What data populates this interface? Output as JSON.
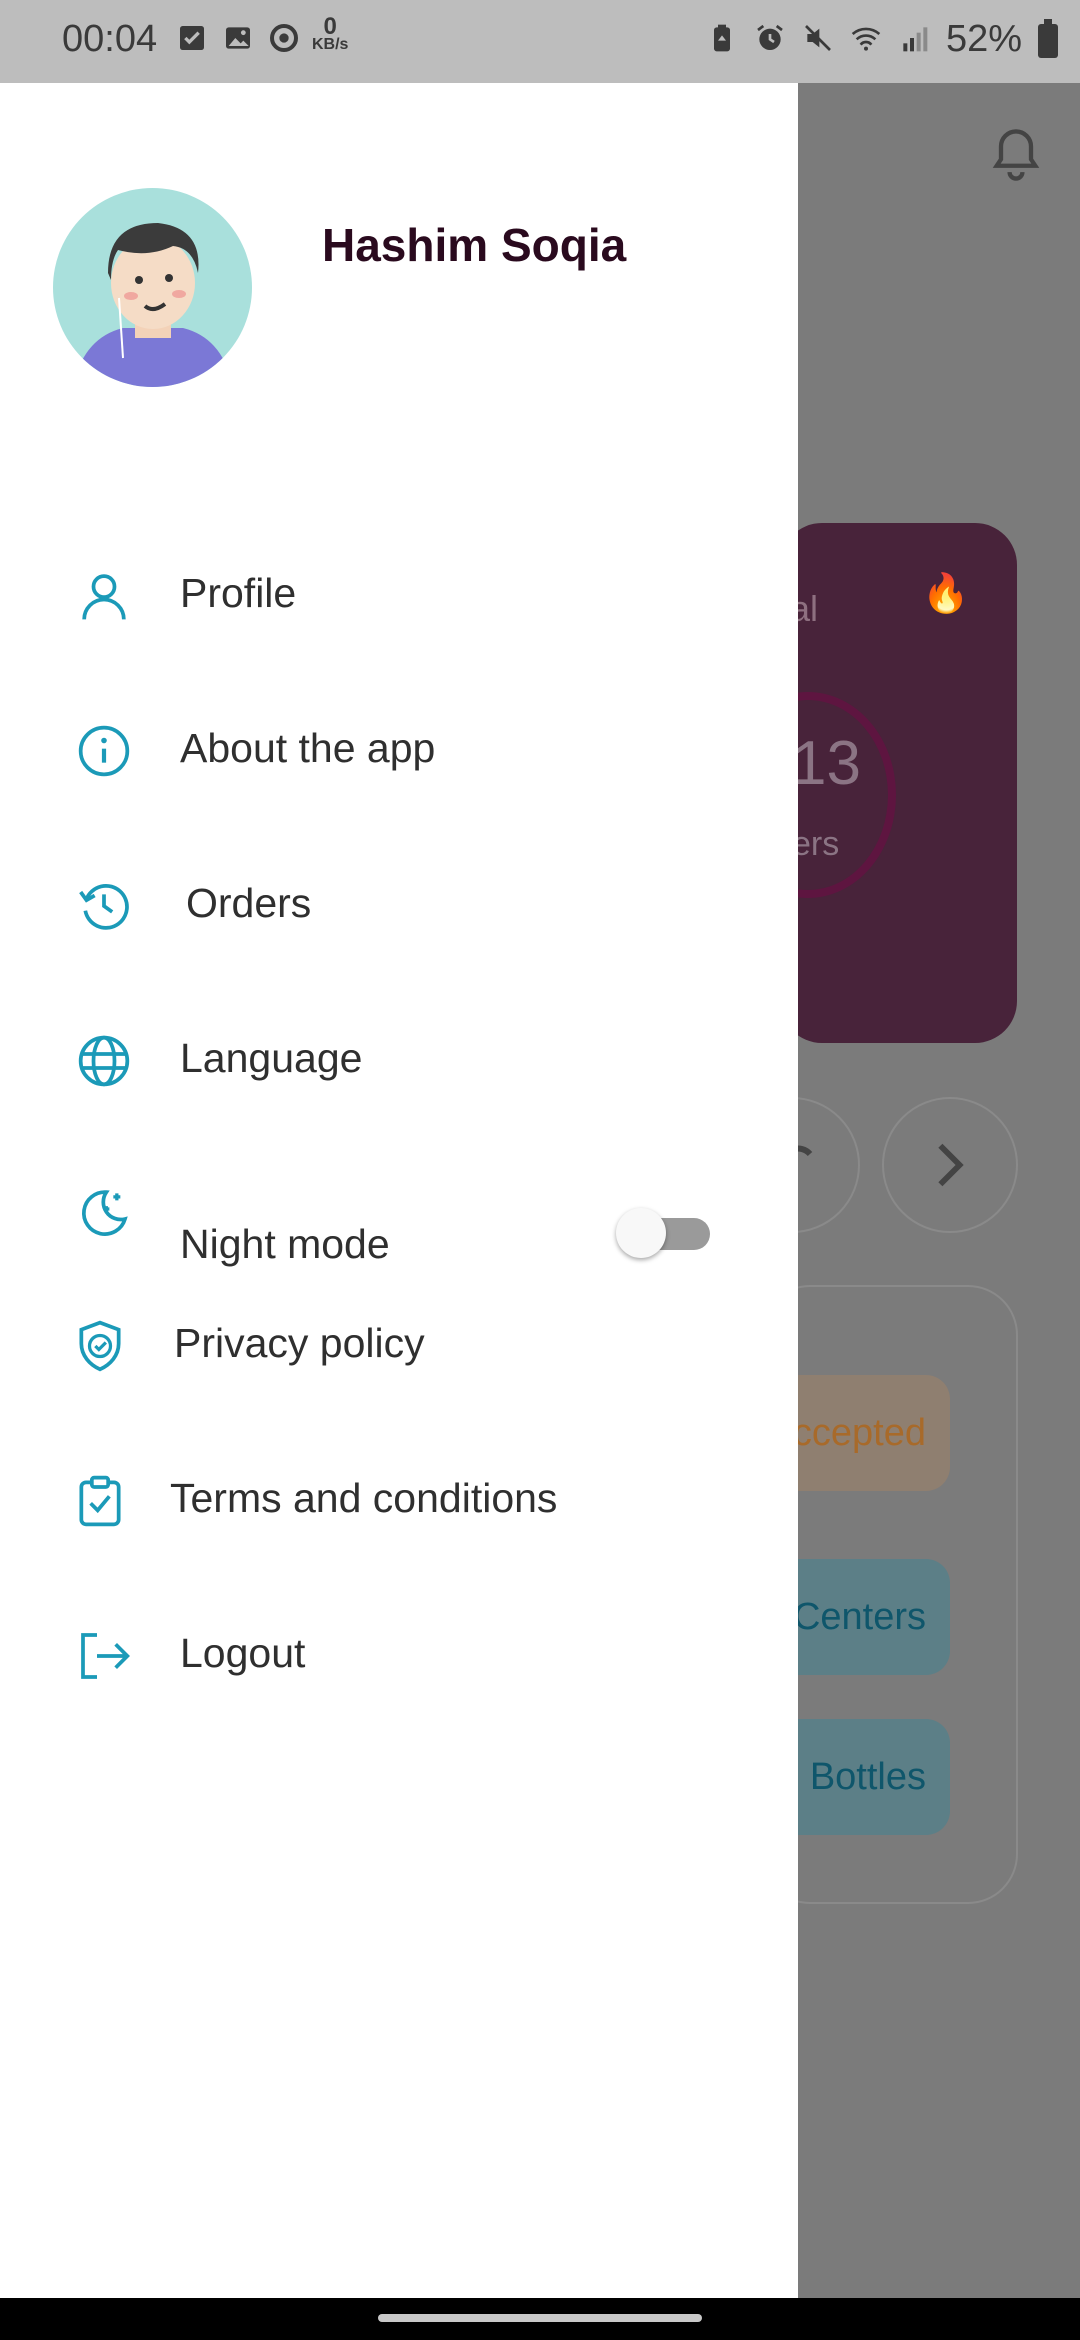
{
  "status_bar": {
    "time": "00:04",
    "network_speed_value": "0",
    "network_speed_unit": "KB/s",
    "battery_percent": "52%",
    "left_icons": [
      "checkbox-icon",
      "image-icon",
      "sync-icon"
    ],
    "right_icons": [
      "battery-saver-icon",
      "alarm-icon",
      "mute-icon",
      "wifi-icon",
      "signal-icon"
    ]
  },
  "drawer": {
    "user_name": "Hashim Soqia",
    "menu": [
      {
        "id": "profile",
        "label": "Profile",
        "icon": "person-icon"
      },
      {
        "id": "about",
        "label": "About the app",
        "icon": "info-icon"
      },
      {
        "id": "orders",
        "label": "Orders",
        "icon": "history-icon"
      },
      {
        "id": "language",
        "label": "Language",
        "icon": "globe-icon"
      },
      {
        "id": "night-mode",
        "label": "Night mode",
        "icon": "moon-icon",
        "toggle_on": false
      },
      {
        "id": "privacy",
        "label": "Privacy policy",
        "icon": "shield-check-icon"
      },
      {
        "id": "terms",
        "label": "Terms and conditions",
        "icon": "clipboard-check-icon"
      },
      {
        "id": "logout",
        "label": "Logout",
        "icon": "logout-icon"
      }
    ]
  },
  "background": {
    "stat_label_fragment": "al",
    "stat_value_fragment": "13",
    "stat_sub_fragment": "ers",
    "chip_accepted": "ccepted",
    "chip_centers": "Centers",
    "chip_bottles": "Bottles"
  },
  "colors": {
    "accent": "#1b9ab8",
    "name": "#2a0a1e",
    "card": "#48233a"
  }
}
